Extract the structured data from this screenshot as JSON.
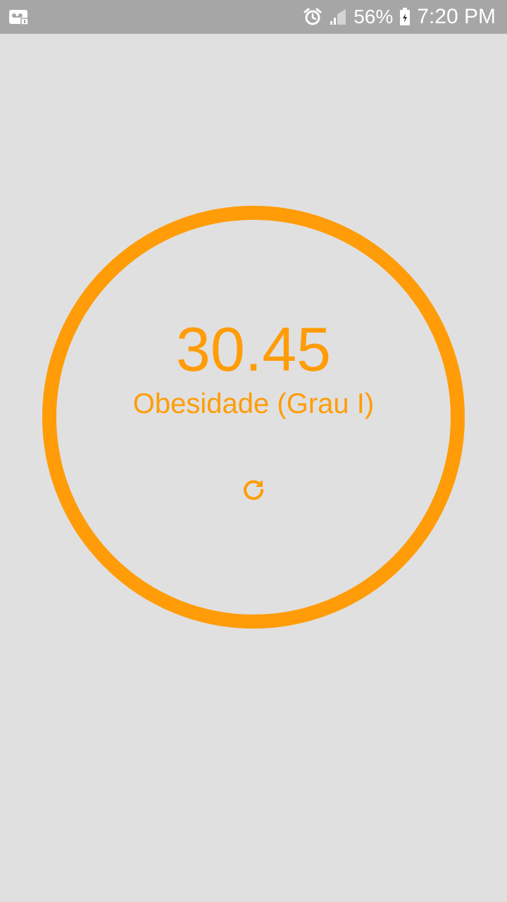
{
  "status_bar": {
    "battery_percent": "56%",
    "time": "7:20 PM",
    "icons": [
      "voicemail-icon",
      "alarm-icon",
      "signal-icon",
      "battery-icon"
    ]
  },
  "result": {
    "bmi_value": "30.45",
    "category": "Obesidade (Grau I)",
    "refresh_icon": "refresh-icon"
  },
  "colors": {
    "accent": "#ff9c08",
    "background": "#e0e0e0",
    "status_bar": "#a6a6a6"
  }
}
